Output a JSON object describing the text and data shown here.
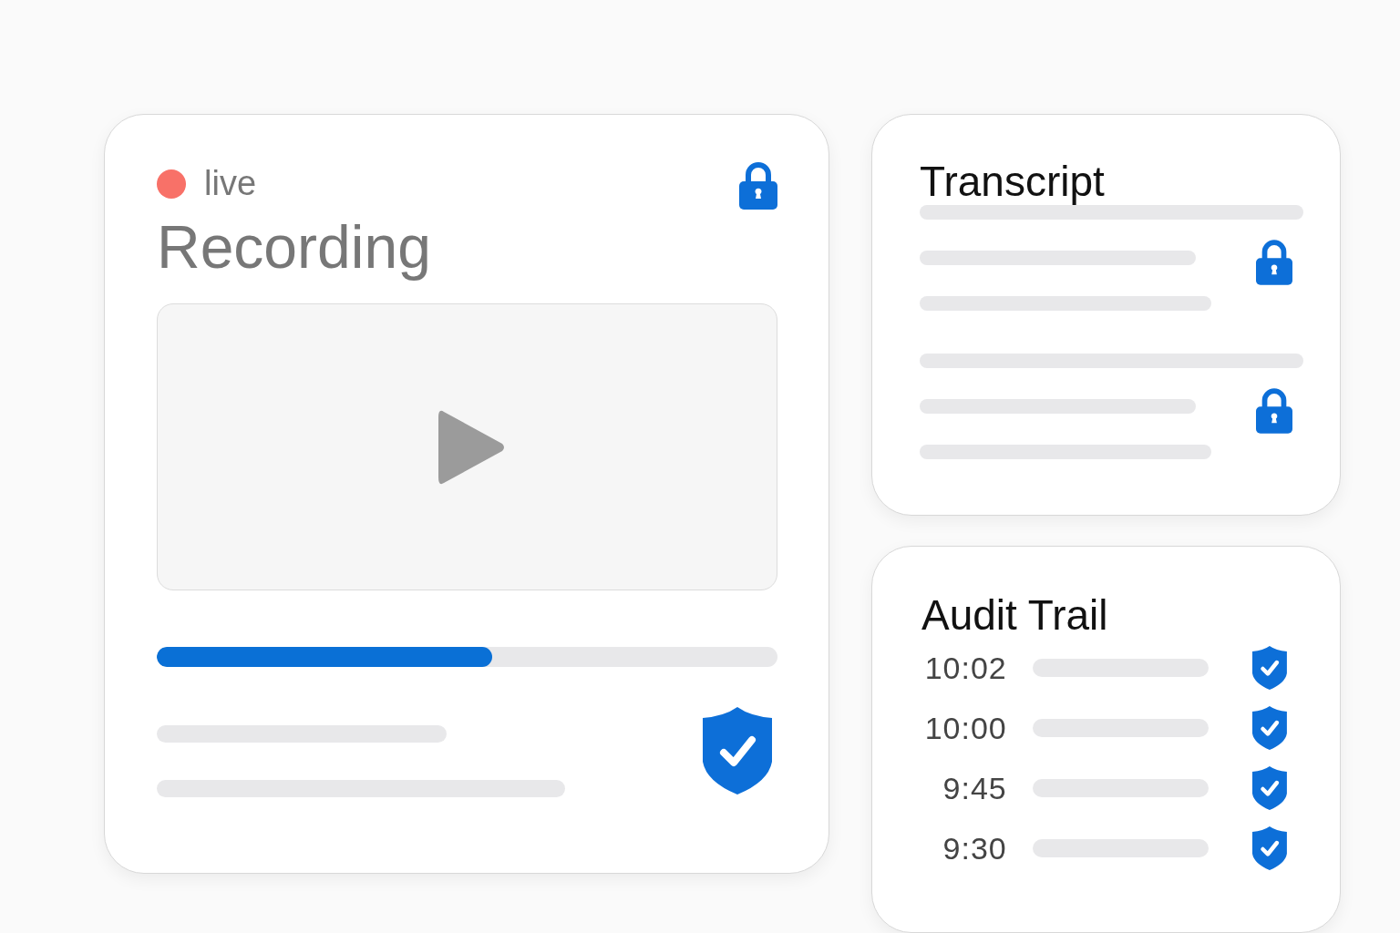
{
  "recording": {
    "status": {
      "label": "live",
      "color": "#f87168"
    },
    "locked": true,
    "title": "Recording",
    "progress": {
      "level": 0.54
    },
    "verified": true
  },
  "transcript": {
    "title": "Transcript",
    "groups": [
      {
        "locked": true
      },
      {
        "locked": true
      }
    ]
  },
  "audit_trail": {
    "title": "Audit Trail",
    "entries": [
      {
        "time": "10:02",
        "verified": true
      },
      {
        "time": "10:00",
        "verified": true
      },
      {
        "time": "9:45",
        "verified": true
      },
      {
        "time": "9:30",
        "verified": true
      }
    ]
  }
}
